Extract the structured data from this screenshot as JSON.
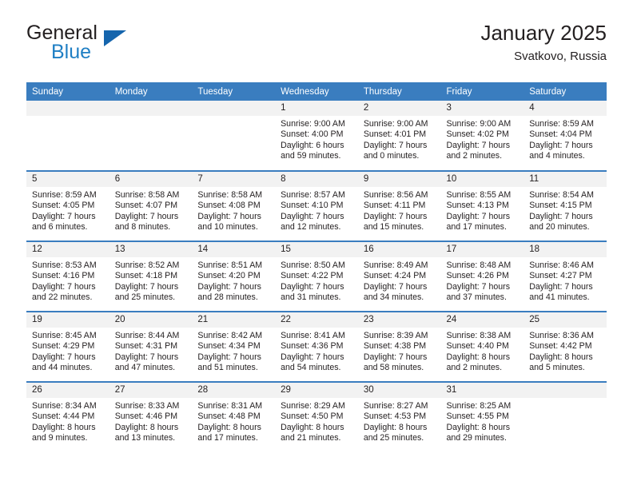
{
  "brand": {
    "line1": "General",
    "line2": "Blue",
    "mark": "triangle-icon"
  },
  "header": {
    "title": "January 2025",
    "subtitle": "Svatkovo, Russia"
  },
  "calendar": {
    "weekday_headers": [
      "Sunday",
      "Monday",
      "Tuesday",
      "Wednesday",
      "Thursday",
      "Friday",
      "Saturday"
    ],
    "colors": {
      "header_blue": "#3a7dbf",
      "daynum_gray": "#f2f2f2",
      "brand_blue": "#1f7fc4",
      "mark_blue": "#1565ad",
      "text": "#231f20"
    },
    "weeks": [
      [
        {
          "day": "",
          "sunrise": "",
          "sunset": "",
          "daylight_1": "",
          "daylight_2": ""
        },
        {
          "day": "",
          "sunrise": "",
          "sunset": "",
          "daylight_1": "",
          "daylight_2": ""
        },
        {
          "day": "",
          "sunrise": "",
          "sunset": "",
          "daylight_1": "",
          "daylight_2": ""
        },
        {
          "day": "1",
          "sunrise": "Sunrise: 9:00 AM",
          "sunset": "Sunset: 4:00 PM",
          "daylight_1": "Daylight: 6 hours",
          "daylight_2": "and 59 minutes."
        },
        {
          "day": "2",
          "sunrise": "Sunrise: 9:00 AM",
          "sunset": "Sunset: 4:01 PM",
          "daylight_1": "Daylight: 7 hours",
          "daylight_2": "and 0 minutes."
        },
        {
          "day": "3",
          "sunrise": "Sunrise: 9:00 AM",
          "sunset": "Sunset: 4:02 PM",
          "daylight_1": "Daylight: 7 hours",
          "daylight_2": "and 2 minutes."
        },
        {
          "day": "4",
          "sunrise": "Sunrise: 8:59 AM",
          "sunset": "Sunset: 4:04 PM",
          "daylight_1": "Daylight: 7 hours",
          "daylight_2": "and 4 minutes."
        }
      ],
      [
        {
          "day": "5",
          "sunrise": "Sunrise: 8:59 AM",
          "sunset": "Sunset: 4:05 PM",
          "daylight_1": "Daylight: 7 hours",
          "daylight_2": "and 6 minutes."
        },
        {
          "day": "6",
          "sunrise": "Sunrise: 8:58 AM",
          "sunset": "Sunset: 4:07 PM",
          "daylight_1": "Daylight: 7 hours",
          "daylight_2": "and 8 minutes."
        },
        {
          "day": "7",
          "sunrise": "Sunrise: 8:58 AM",
          "sunset": "Sunset: 4:08 PM",
          "daylight_1": "Daylight: 7 hours",
          "daylight_2": "and 10 minutes."
        },
        {
          "day": "8",
          "sunrise": "Sunrise: 8:57 AM",
          "sunset": "Sunset: 4:10 PM",
          "daylight_1": "Daylight: 7 hours",
          "daylight_2": "and 12 minutes."
        },
        {
          "day": "9",
          "sunrise": "Sunrise: 8:56 AM",
          "sunset": "Sunset: 4:11 PM",
          "daylight_1": "Daylight: 7 hours",
          "daylight_2": "and 15 minutes."
        },
        {
          "day": "10",
          "sunrise": "Sunrise: 8:55 AM",
          "sunset": "Sunset: 4:13 PM",
          "daylight_1": "Daylight: 7 hours",
          "daylight_2": "and 17 minutes."
        },
        {
          "day": "11",
          "sunrise": "Sunrise: 8:54 AM",
          "sunset": "Sunset: 4:15 PM",
          "daylight_1": "Daylight: 7 hours",
          "daylight_2": "and 20 minutes."
        }
      ],
      [
        {
          "day": "12",
          "sunrise": "Sunrise: 8:53 AM",
          "sunset": "Sunset: 4:16 PM",
          "daylight_1": "Daylight: 7 hours",
          "daylight_2": "and 22 minutes."
        },
        {
          "day": "13",
          "sunrise": "Sunrise: 8:52 AM",
          "sunset": "Sunset: 4:18 PM",
          "daylight_1": "Daylight: 7 hours",
          "daylight_2": "and 25 minutes."
        },
        {
          "day": "14",
          "sunrise": "Sunrise: 8:51 AM",
          "sunset": "Sunset: 4:20 PM",
          "daylight_1": "Daylight: 7 hours",
          "daylight_2": "and 28 minutes."
        },
        {
          "day": "15",
          "sunrise": "Sunrise: 8:50 AM",
          "sunset": "Sunset: 4:22 PM",
          "daylight_1": "Daylight: 7 hours",
          "daylight_2": "and 31 minutes."
        },
        {
          "day": "16",
          "sunrise": "Sunrise: 8:49 AM",
          "sunset": "Sunset: 4:24 PM",
          "daylight_1": "Daylight: 7 hours",
          "daylight_2": "and 34 minutes."
        },
        {
          "day": "17",
          "sunrise": "Sunrise: 8:48 AM",
          "sunset": "Sunset: 4:26 PM",
          "daylight_1": "Daylight: 7 hours",
          "daylight_2": "and 37 minutes."
        },
        {
          "day": "18",
          "sunrise": "Sunrise: 8:46 AM",
          "sunset": "Sunset: 4:27 PM",
          "daylight_1": "Daylight: 7 hours",
          "daylight_2": "and 41 minutes."
        }
      ],
      [
        {
          "day": "19",
          "sunrise": "Sunrise: 8:45 AM",
          "sunset": "Sunset: 4:29 PM",
          "daylight_1": "Daylight: 7 hours",
          "daylight_2": "and 44 minutes."
        },
        {
          "day": "20",
          "sunrise": "Sunrise: 8:44 AM",
          "sunset": "Sunset: 4:31 PM",
          "daylight_1": "Daylight: 7 hours",
          "daylight_2": "and 47 minutes."
        },
        {
          "day": "21",
          "sunrise": "Sunrise: 8:42 AM",
          "sunset": "Sunset: 4:34 PM",
          "daylight_1": "Daylight: 7 hours",
          "daylight_2": "and 51 minutes."
        },
        {
          "day": "22",
          "sunrise": "Sunrise: 8:41 AM",
          "sunset": "Sunset: 4:36 PM",
          "daylight_1": "Daylight: 7 hours",
          "daylight_2": "and 54 minutes."
        },
        {
          "day": "23",
          "sunrise": "Sunrise: 8:39 AM",
          "sunset": "Sunset: 4:38 PM",
          "daylight_1": "Daylight: 7 hours",
          "daylight_2": "and 58 minutes."
        },
        {
          "day": "24",
          "sunrise": "Sunrise: 8:38 AM",
          "sunset": "Sunset: 4:40 PM",
          "daylight_1": "Daylight: 8 hours",
          "daylight_2": "and 2 minutes."
        },
        {
          "day": "25",
          "sunrise": "Sunrise: 8:36 AM",
          "sunset": "Sunset: 4:42 PM",
          "daylight_1": "Daylight: 8 hours",
          "daylight_2": "and 5 minutes."
        }
      ],
      [
        {
          "day": "26",
          "sunrise": "Sunrise: 8:34 AM",
          "sunset": "Sunset: 4:44 PM",
          "daylight_1": "Daylight: 8 hours",
          "daylight_2": "and 9 minutes."
        },
        {
          "day": "27",
          "sunrise": "Sunrise: 8:33 AM",
          "sunset": "Sunset: 4:46 PM",
          "daylight_1": "Daylight: 8 hours",
          "daylight_2": "and 13 minutes."
        },
        {
          "day": "28",
          "sunrise": "Sunrise: 8:31 AM",
          "sunset": "Sunset: 4:48 PM",
          "daylight_1": "Daylight: 8 hours",
          "daylight_2": "and 17 minutes."
        },
        {
          "day": "29",
          "sunrise": "Sunrise: 8:29 AM",
          "sunset": "Sunset: 4:50 PM",
          "daylight_1": "Daylight: 8 hours",
          "daylight_2": "and 21 minutes."
        },
        {
          "day": "30",
          "sunrise": "Sunrise: 8:27 AM",
          "sunset": "Sunset: 4:53 PM",
          "daylight_1": "Daylight: 8 hours",
          "daylight_2": "and 25 minutes."
        },
        {
          "day": "31",
          "sunrise": "Sunrise: 8:25 AM",
          "sunset": "Sunset: 4:55 PM",
          "daylight_1": "Daylight: 8 hours",
          "daylight_2": "and 29 minutes."
        },
        {
          "day": "",
          "sunrise": "",
          "sunset": "",
          "daylight_1": "",
          "daylight_2": ""
        }
      ]
    ]
  }
}
